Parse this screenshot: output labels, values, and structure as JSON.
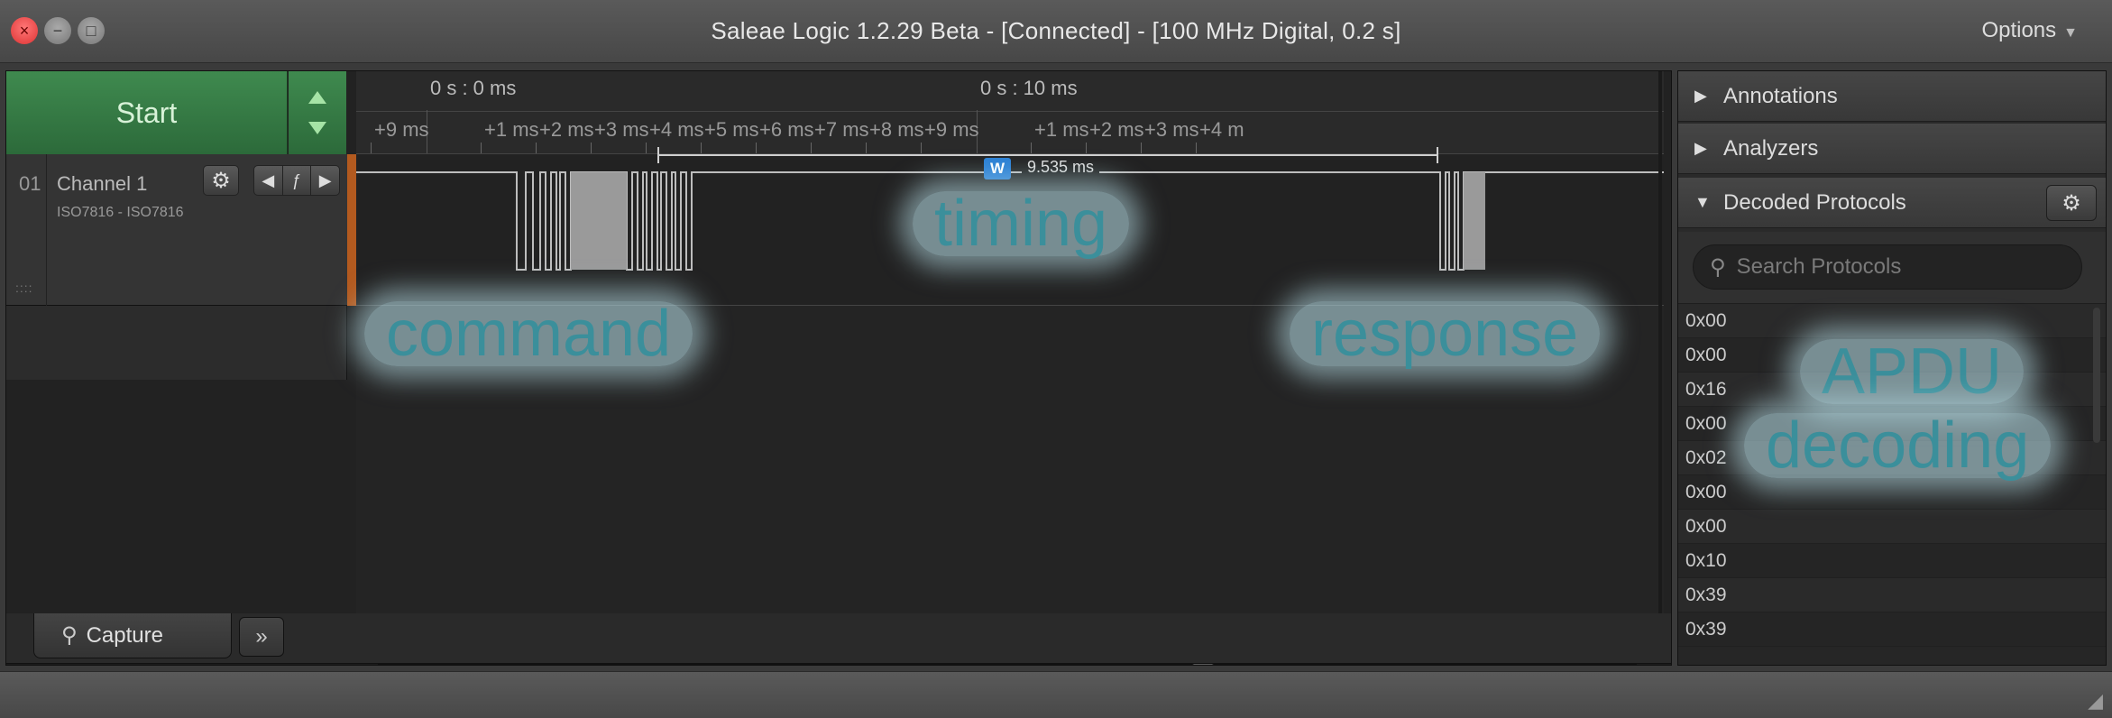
{
  "window": {
    "title": "Saleae Logic 1.2.29 Beta - [Connected] - [100 MHz Digital, 0.2 s]",
    "options_label": "Options",
    "close_glyph": "×",
    "minimize_glyph": "−",
    "maximize_glyph": "□"
  },
  "controls": {
    "start_label": "Start"
  },
  "channel": {
    "number": "01",
    "name": "Channel 1",
    "protocol": "ISO7816 - ISO7816",
    "grip": "::::",
    "trigger_left": "◀",
    "trigger_edge": "ƒ",
    "trigger_right": "▶",
    "color": "#b35a1f"
  },
  "timeline": {
    "abs_times": [
      "0 s : 0 ms",
      "0 s : 10 ms"
    ],
    "tick_labels": [
      "+9 ms",
      "+1 ms",
      "+2 ms",
      "+3 ms",
      "+4 ms",
      "+5 ms",
      "+6 ms",
      "+7 ms",
      "+8 ms",
      "+9 ms",
      "+1 ms",
      "+2 ms",
      "+3 ms",
      "+4 m"
    ]
  },
  "measurement": {
    "badge": "W",
    "value": "9.535 ms"
  },
  "tabs": {
    "capture_label": "Capture",
    "more_glyph": "»"
  },
  "right_panel": {
    "annotations_label": "Annotations",
    "analyzers_label": "Analyzers",
    "decoded_protocols_label": "Decoded Protocols",
    "search_placeholder": "Search Protocols",
    "rows": [
      "0x00",
      "0x00",
      "0x16",
      "0x00",
      "0x02",
      "0x00",
      "0x00",
      "0x10",
      "0x39",
      "0x39"
    ]
  },
  "overlays": {
    "timing": "timing",
    "command": "command",
    "response": "response",
    "apdu": "APDU",
    "decoding": "decoding"
  },
  "icons": {
    "gear": "⚙",
    "triangle_right": "▶",
    "triangle_down": "▼",
    "search": "⚲",
    "resize": "◢"
  },
  "colors": {
    "start_green": "#3f8a4f",
    "accent_blue": "#2a7fd4",
    "overlay_text": "#3b8f9b"
  }
}
